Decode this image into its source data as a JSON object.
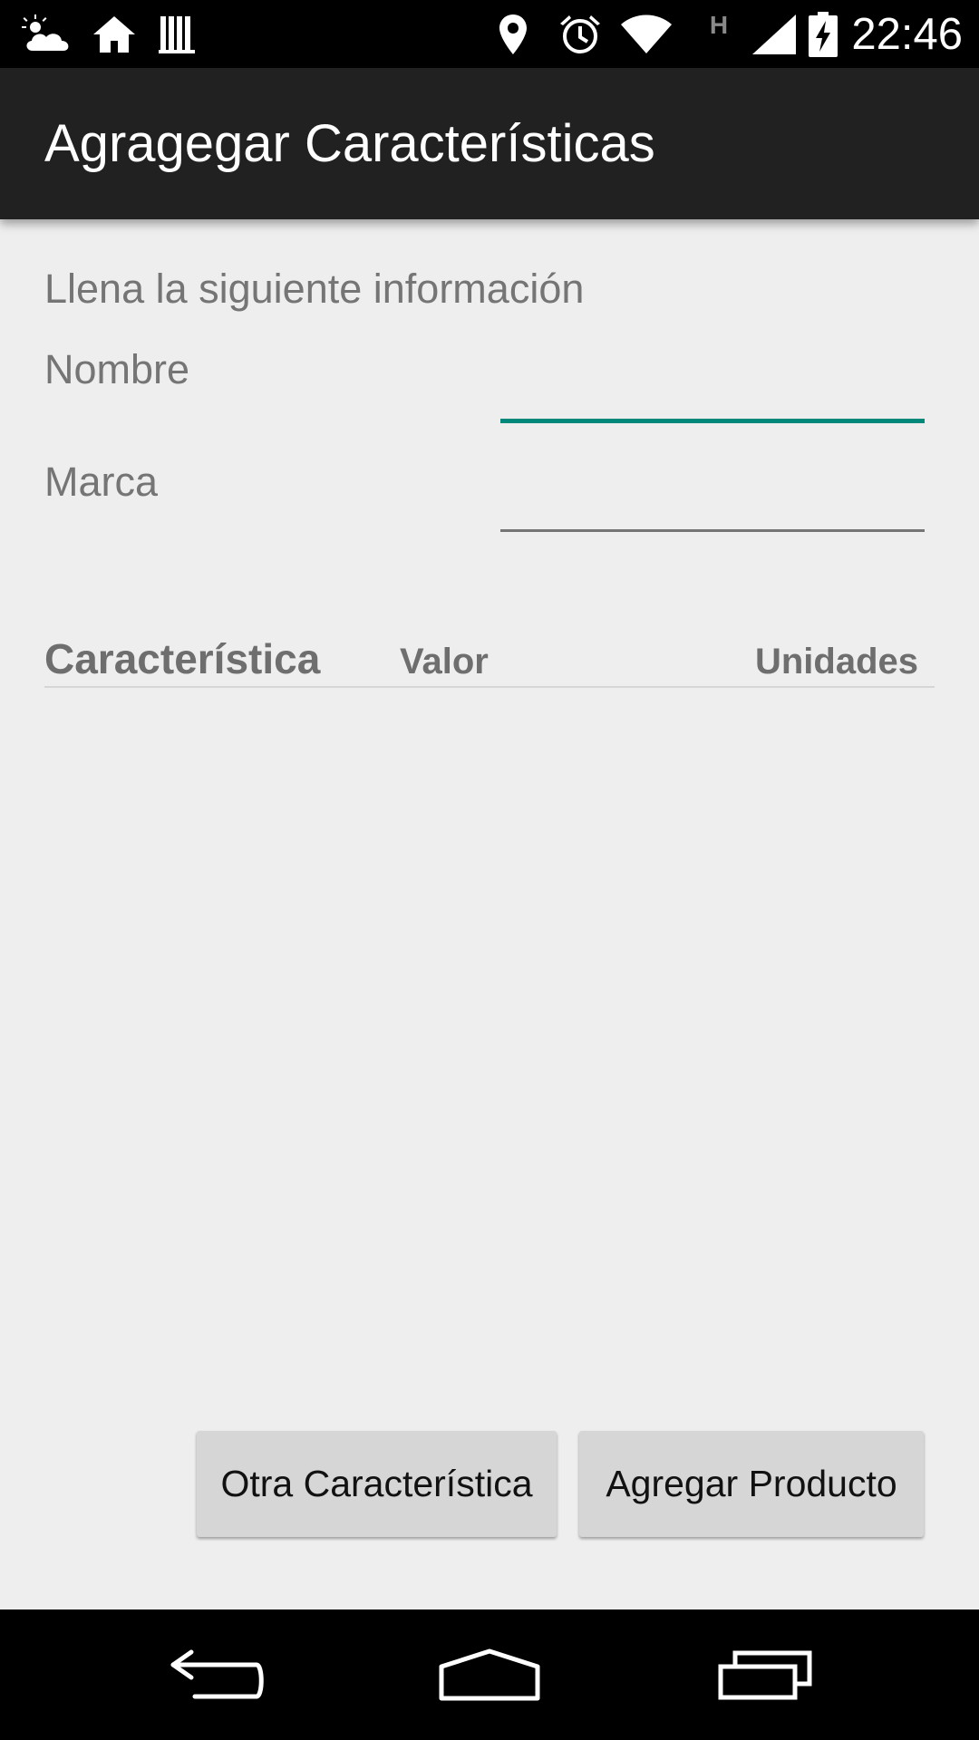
{
  "status_bar": {
    "time": "22:46",
    "network_label": "H",
    "icons_left": [
      "weather-icon",
      "home-icon",
      "library-icon"
    ],
    "icons_right": [
      "location-icon",
      "alarm-icon",
      "wifi-icon",
      "network-type-icon",
      "signal-icon",
      "battery-charging-icon"
    ]
  },
  "action_bar": {
    "title": "Agragegar Características"
  },
  "form": {
    "instructions": "Llena la siguiente información",
    "nombre_label": "Nombre",
    "nombre_value": "",
    "marca_label": "Marca",
    "marca_value": ""
  },
  "table": {
    "headers": [
      "Característica",
      "Valor",
      "Unidades"
    ],
    "rows": []
  },
  "buttons": {
    "otra_label": "Otra Característica",
    "agregar_label": "Agregar Producto"
  },
  "nav_bar": {
    "icons": [
      "back-icon",
      "home-nav-icon",
      "recents-icon"
    ]
  },
  "colors": {
    "accent": "#00897b",
    "action_bar": "#212121",
    "background": "#eeeeee",
    "button": "#d6d6d6"
  }
}
